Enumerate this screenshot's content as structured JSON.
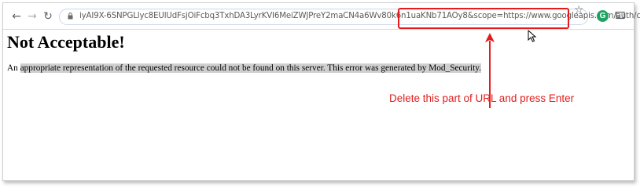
{
  "browser": {
    "url_visible": "iyAI9X-6SNPGLlyc8EUlUdFsjOiFcbq3TxhDA3LyrKVI6MeiZWJPreY2maCN4a6Wv80k6n1uaKNb71AOy8&scope=https://www.googleapis.com/auth/calendar",
    "extension_letter": "G"
  },
  "page": {
    "heading": "Not Acceptable!",
    "message_prefix": "An ",
    "message_selected": "appropriate representation of the requested resource could not be found on this server. This error was generated by Mod_Security."
  },
  "annotation": {
    "text": "Delete this part of URL and press Enter",
    "color": "#e11d1d"
  }
}
